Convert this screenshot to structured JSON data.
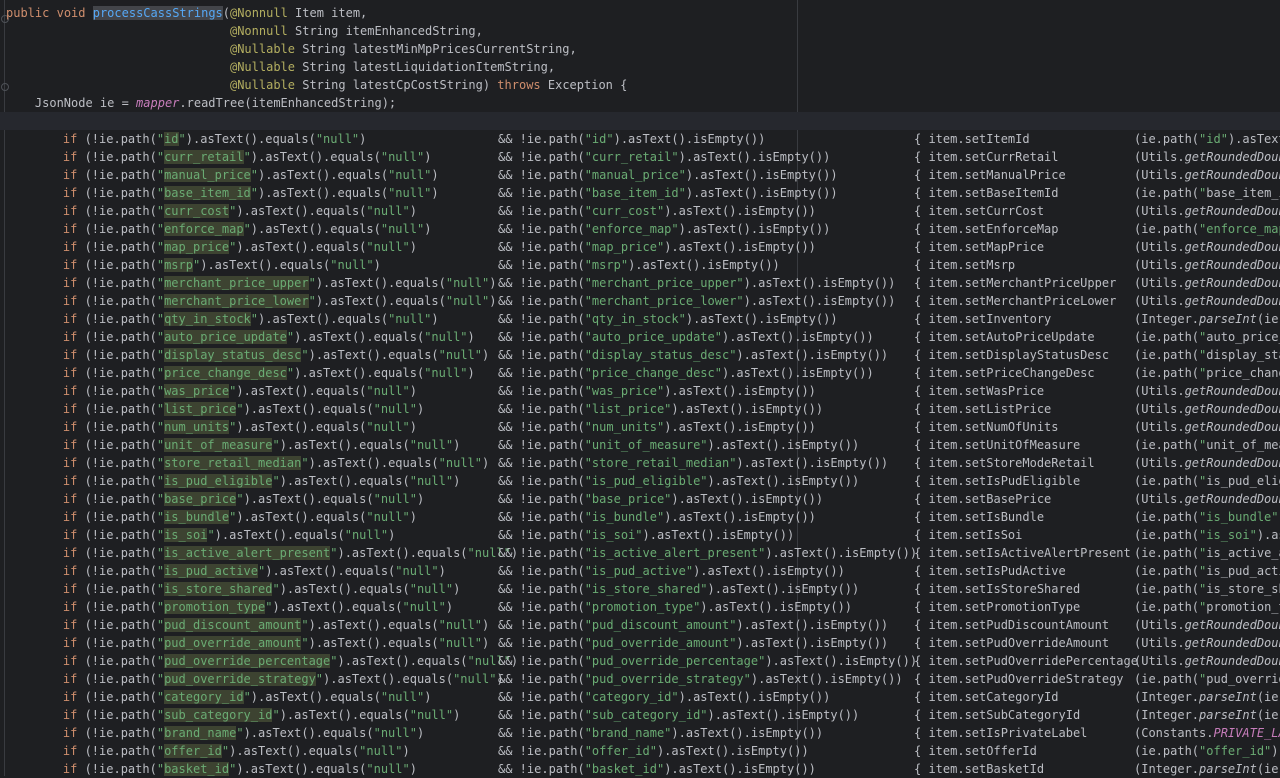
{
  "editor": {
    "header": [
      "public void processCassStrings(@Nonnull Item item,",
      "                               @Nonnull String itemEnhancedString,",
      "                               @Nullable String latestMinMpPricesCurrentString,",
      "                               @Nullable String latestLiquidationItemString,",
      "                               @Nullable String latestCpCostString) throws Exception {",
      "    JsonNode ie = mapper.readTree(itemEnhancedString);",
      ""
    ],
    "rows": [
      {
        "key": "id",
        "setter": "setItemId",
        "value": "(ie.path(\"id\").asText("
      },
      {
        "key": "curr_retail",
        "setter": "setCurrRetail",
        "value": "(Utils.getRoundedDoubl"
      },
      {
        "key": "manual_price",
        "setter": "setManualPrice",
        "value": "(Utils.getRoundedDoubl"
      },
      {
        "key": "base_item_id",
        "setter": "setBaseItemId",
        "value": "(ie.path(\"base_item_id"
      },
      {
        "key": "curr_cost",
        "setter": "setCurrCost",
        "value": "(Utils.getRoundedDoubl"
      },
      {
        "key": "enforce_map",
        "setter": "setEnforceMap",
        "value": "(ie.path(\"enforce_map\""
      },
      {
        "key": "map_price",
        "setter": "setMapPrice",
        "value": "(Utils.getRoundedDoubl"
      },
      {
        "key": "msrp",
        "setter": "setMsrp",
        "value": "(Utils.getRoundedDoubl"
      },
      {
        "key": "merchant_price_upper",
        "setter": "setMerchantPriceUpper",
        "value": "(Utils.getRoundedDoubl"
      },
      {
        "key": "merchant_price_lower",
        "setter": "setMerchantPriceLower",
        "value": "(Utils.getRoundedDoubl"
      },
      {
        "key": "qty_in_stock",
        "setter": "setInventory",
        "value": "(Integer.parseInt(ie.p"
      },
      {
        "key": "auto_price_update",
        "setter": "setAutoPriceUpdate",
        "value": "(ie.path(\"auto_price_u"
      },
      {
        "key": "display_status_desc",
        "setter": "setDisplayStatusDesc",
        "value": "(ie.path(\"display_stat"
      },
      {
        "key": "price_change_desc",
        "setter": "setPriceChangeDesc",
        "value": "(ie.path(\"price_change"
      },
      {
        "key": "was_price",
        "setter": "setWasPrice",
        "value": "(Utils.getRoundedDoubl"
      },
      {
        "key": "list_price",
        "setter": "setListPrice",
        "value": "(Utils.getRoundedDoubl"
      },
      {
        "key": "num_units",
        "setter": "setNumOfUnits",
        "value": "(Utils.getRoundedDoubl"
      },
      {
        "key": "unit_of_measure",
        "setter": "setUnitOfMeasure",
        "value": "(ie.path(\"unit_of_meas"
      },
      {
        "key": "store_retail_median",
        "setter": "setStoreModeRetail",
        "value": "(Utils.getRoundedDoubl"
      },
      {
        "key": "is_pud_eligible",
        "setter": "setIsPudEligible",
        "value": "(ie.path(\"is_pud_elig"
      },
      {
        "key": "base_price",
        "setter": "setBasePrice",
        "value": "(Utils.getRoundedDoubl"
      },
      {
        "key": "is_bundle",
        "setter": "setIsBundle",
        "value": "(ie.path(\"is_bundle\")."
      },
      {
        "key": "is_soi",
        "setter": "setIsSoi",
        "value": "(ie.path(\"is_soi\").as"
      },
      {
        "key": "is_active_alert_present",
        "setter": "setIsActiveAlertPresent",
        "value": "(ie.path(\"is_active_al"
      },
      {
        "key": "is_pud_active",
        "setter": "setIsPudActive",
        "value": "(ie.path(\"is_pud_activ"
      },
      {
        "key": "is_store_shared",
        "setter": "setIsStoreShared",
        "value": "(ie.path(\"is_store_sha"
      },
      {
        "key": "promotion_type",
        "setter": "setPromotionType",
        "value": "(ie.path(\"promotion_ty"
      },
      {
        "key": "pud_discount_amount",
        "setter": "setPudDiscountAmount",
        "value": "(Utils.getRoundedDoubl"
      },
      {
        "key": "pud_override_amount",
        "setter": "setPudOverrideAmount",
        "value": "(Utils.getRoundedDoubl"
      },
      {
        "key": "pud_override_percentage",
        "setter": "setPudOverridePercentage",
        "value": "(Utils.getRoundedDoubl"
      },
      {
        "key": "pud_override_strategy",
        "setter": "setPudOverrideStrategy",
        "value": "(ie.path(\"pud_override"
      },
      {
        "key": "category_id",
        "setter": "setCategoryId",
        "value": "(Integer.parseInt(ie.p"
      },
      {
        "key": "sub_category_id",
        "setter": "setSubCategoryId",
        "value": "(Integer.parseInt(ie.p"
      },
      {
        "key": "brand_name",
        "setter": "setIsPrivateLabel",
        "value": "(Constants.PRIVATE_LAB"
      },
      {
        "key": "offer_id",
        "setter": "setOfferId",
        "value": "(ie.path(\"offer_id\").a"
      },
      {
        "key": "basket_id",
        "setter": "setBasketId",
        "value": "(Integer.parseInt(ie.p"
      }
    ]
  },
  "colors": {
    "background": "#1e1f22",
    "keyword": "#cf8e6d",
    "string": "#6aab73",
    "annotation": "#b3ae60",
    "field": "#c77dbb",
    "method_declaration": "#56a8f5",
    "text": "#bcbec4"
  }
}
